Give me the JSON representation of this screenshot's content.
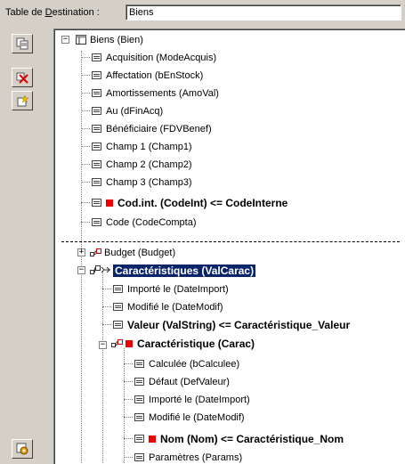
{
  "header": {
    "label_pre": "Table de ",
    "label_accel": "D",
    "label_post": "estination :",
    "table_value": "Biens"
  },
  "toolbar": {
    "buttons": [
      {
        "icon": "copy-table-icon"
      },
      {
        "icon": "delete-link-icon"
      },
      {
        "icon": "new-item-icon"
      },
      {
        "icon": "settings-icon"
      }
    ]
  },
  "tree": {
    "root": "Biens (Bien)",
    "fields": [
      "Acquisition (ModeAcquis)",
      "Affectation (bEnStock)",
      "Amortissements (AmoVal)",
      "Au (dFinAcq)",
      "Bénéficiaire (FDVBenef)",
      "Champ 1 (Champ1)",
      "Champ 2 (Champ2)",
      "Champ 3 (Champ3)"
    ],
    "mapped1": "Cod.int. (CodeInt)  <=  CodeInterne",
    "code": "Code (CodeCompta)",
    "budget": "Budget (Budget)",
    "carac_sel": "Caractéristiques (ValCarac)",
    "carac_children": [
      "Importé le (DateImport)",
      "Modifié le (DateModif)"
    ],
    "valeur": "Valeur (ValString)  <=  Caractéristique_Valeur",
    "carac": "Caractéristique (Carac)",
    "carac_fields": [
      "Calculée (bCalculee)",
      "Défaut (DefValeur)",
      "Importé le (DateImport)",
      "Modifié le (DateModif)"
    ],
    "nom": "Nom (Nom)  <=  Caractéristique_Nom",
    "params": "Paramètres (Params)"
  }
}
